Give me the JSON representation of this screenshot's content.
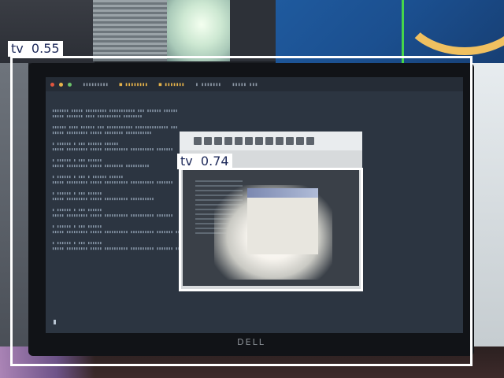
{
  "detections": [
    {
      "label": "tv",
      "score": "0.55"
    },
    {
      "label": "tv",
      "score": "0.74"
    }
  ],
  "monitor": {
    "brand": "DELL"
  },
  "colors": {
    "box": "#ffffff",
    "label_text": "#1e2a5a"
  }
}
